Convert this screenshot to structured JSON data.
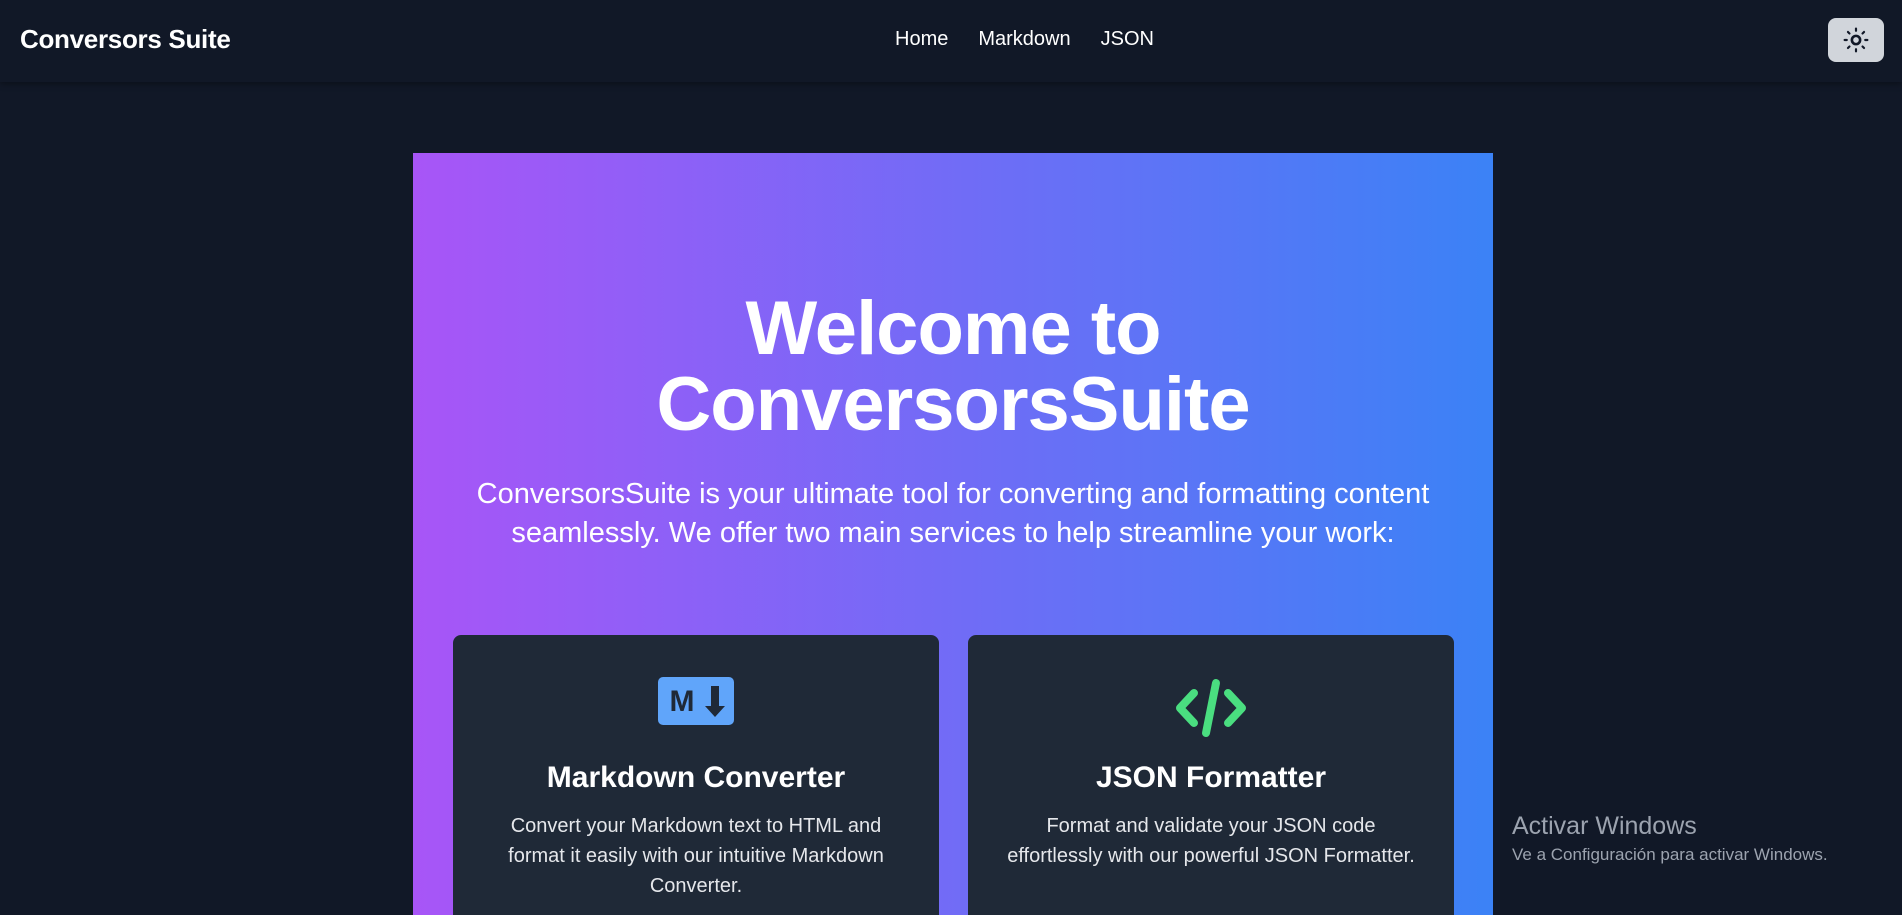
{
  "header": {
    "brand": "Conversors Suite",
    "nav": [
      "Home",
      "Markdown",
      "JSON"
    ]
  },
  "hero": {
    "title_line1": "Welcome to",
    "title_line2": "ConversorsSuite",
    "description": "ConversorsSuite is your ultimate tool for converting and formatting content seamlessly. We offer two main services to help streamline your work:"
  },
  "cards": [
    {
      "icon": "markdown-icon",
      "icon_text": "M",
      "title": "Markdown Converter",
      "description": "Convert your Markdown text to HTML and format it easily with our intuitive Markdown Converter."
    },
    {
      "icon": "code-icon",
      "title": "JSON Formatter",
      "description": "Format and validate your JSON code effortlessly with our powerful JSON Formatter."
    }
  ],
  "watermark": {
    "title": "Activar Windows",
    "subtitle": "Ve a Configuración para activar Windows."
  },
  "colors": {
    "background": "#111827",
    "gradient_start": "#a855f7",
    "gradient_end": "#3b82f6",
    "card": "#1f2937",
    "markdown_icon": "#60a5fa",
    "code_icon": "#4ade80"
  }
}
